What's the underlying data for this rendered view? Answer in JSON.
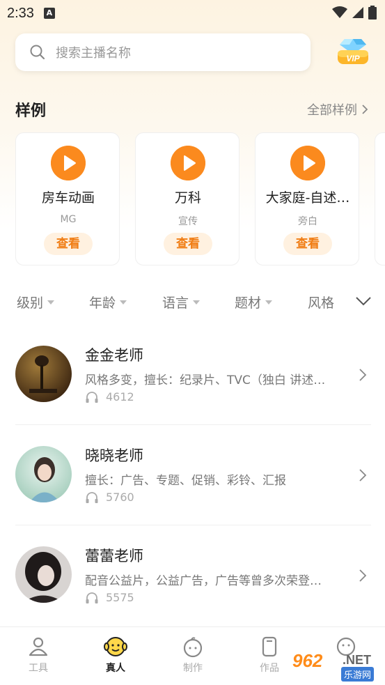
{
  "status_bar": {
    "time": "2:33",
    "a_label": "A"
  },
  "search": {
    "placeholder": "搜索主播名称"
  },
  "vip": {
    "label": "VIP"
  },
  "samples": {
    "title": "样例",
    "more_label": "全部样例",
    "cards": [
      {
        "title": "房车动画",
        "category": "MG",
        "button": "查看"
      },
      {
        "title": "万科",
        "category": "宣传",
        "button": "查看"
      },
      {
        "title": "大家庭-自述…",
        "category": "旁白",
        "button": "查看"
      }
    ]
  },
  "filters": [
    "级别",
    "年龄",
    "语言",
    "题材",
    "风格"
  ],
  "teachers": [
    {
      "name": "金金老师",
      "desc": "风格多变，擅长：纪录片、TVC（独白 讲述…",
      "plays": "4612"
    },
    {
      "name": "晓晓老师",
      "desc": "擅长：广告、专题、促销、彩铃、汇报",
      "plays": "5760"
    },
    {
      "name": "蕾蕾老师",
      "desc": "配音公益片，公益广告，广告等曾多次荣登…",
      "plays": "5575"
    }
  ],
  "tabbar": {
    "tabs": [
      {
        "label": "工具",
        "active": false
      },
      {
        "label": "真人",
        "active": true
      },
      {
        "label": "制作",
        "active": false
      },
      {
        "label": "作品",
        "active": false
      },
      {
        "label": "",
        "active": false
      }
    ]
  },
  "watermark": {
    "number": "962",
    "net": ".NET",
    "cn": "乐游网"
  },
  "colors": {
    "accent": "#fb8a1e",
    "accent_light": "#fff1e0",
    "text": "#222222",
    "muted": "#999999"
  }
}
